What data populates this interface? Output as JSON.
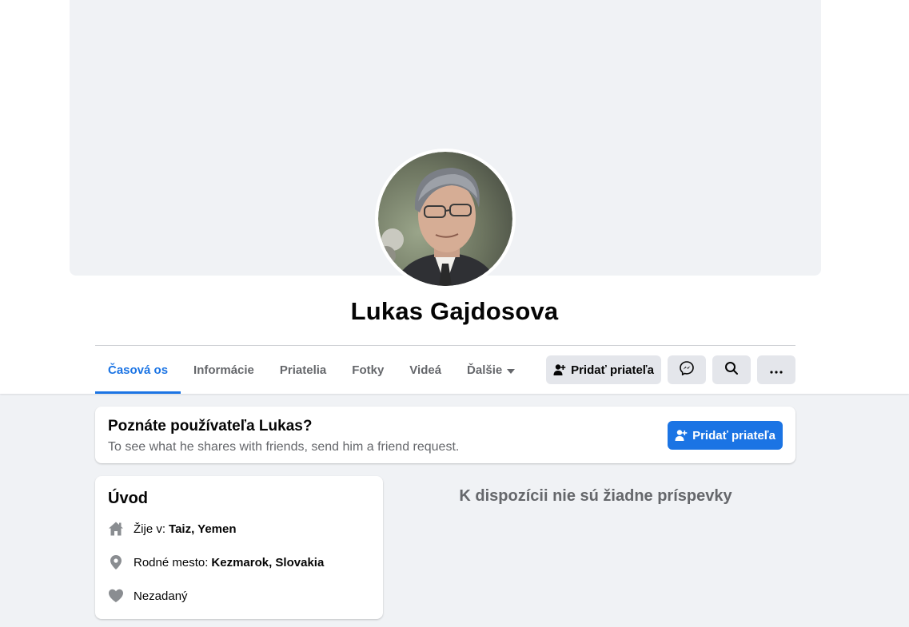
{
  "profile": {
    "name": "Lukas Gajdosova"
  },
  "tabs": [
    {
      "label": "Časová os",
      "active": true
    },
    {
      "label": "Informácie"
    },
    {
      "label": "Priatelia"
    },
    {
      "label": "Fotky"
    },
    {
      "label": "Videá"
    },
    {
      "label": "Ďalšie"
    }
  ],
  "actions": {
    "add_friend_label": "Pridať priateľa",
    "icons": [
      "add-friend-icon",
      "messenger-icon",
      "search-icon",
      "more-icon"
    ]
  },
  "know_card": {
    "title": "Poznáte používateľa Lukas?",
    "subtitle": "To see what he shares with friends, send him a friend request.",
    "button_label": "Pridať priateľa"
  },
  "intro": {
    "title": "Úvod",
    "lives_in_label": "Žije v:",
    "lives_in_value": "Taiz, Yemen",
    "hometown_label": "Rodné mesto:",
    "hometown_value": "Kezmarok, Slovakia",
    "relationship": "Nezadaný"
  },
  "posts": {
    "empty_message": "K dispozícii nie sú žiadne príspevky"
  },
  "colors": {
    "accent": "#1b74e4",
    "background": "#f0f2f5",
    "secondary_text": "#65676b",
    "button_gray": "#e4e6eb"
  }
}
